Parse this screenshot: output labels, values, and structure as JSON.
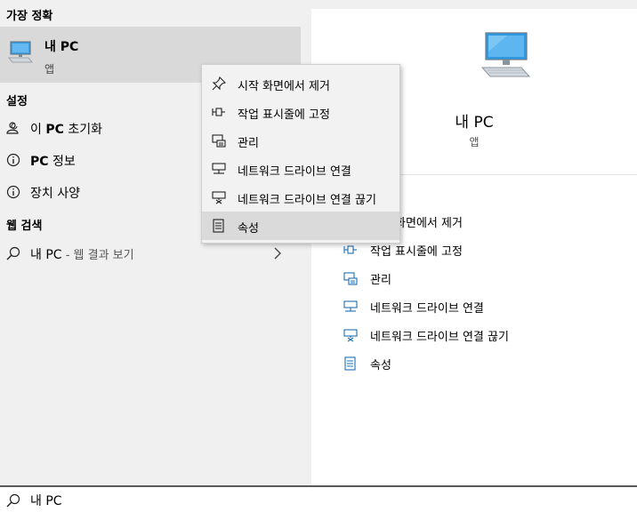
{
  "left": {
    "best_match_header": "가장 정확",
    "best_match": {
      "title": "내 PC",
      "subtitle": "앱"
    },
    "settings_header": "설정",
    "settings": [
      {
        "prefix": "이 ",
        "bold": "PC",
        "suffix": " 초기화",
        "icon": "reset-user-icon"
      },
      {
        "prefix": "",
        "bold": "PC",
        "suffix": " 정보",
        "icon": "info-icon"
      },
      {
        "prefix": "",
        "bold": "",
        "suffix": "장치 사양",
        "icon": "info-icon"
      }
    ],
    "web_header": "웹 검색",
    "web_result": {
      "text": "내 PC",
      "suffix": " - 웹 결과 보기"
    }
  },
  "preview": {
    "title": "내 PC",
    "subtitle": "앱",
    "actions": [
      {
        "label": "시작 화면에서 제거",
        "icon": "unpin-icon"
      },
      {
        "label": "작업 표시줄에 고정",
        "icon": "pin-icon"
      },
      {
        "label": "관리",
        "icon": "manage-icon"
      },
      {
        "label": "네트워크 드라이브 연결",
        "icon": "map-network-drive-icon"
      },
      {
        "label": "네트워크 드라이브 연결 끊기",
        "icon": "disconnect-network-drive-icon"
      },
      {
        "label": "속성",
        "icon": "properties-icon"
      }
    ]
  },
  "context_menu": {
    "items": [
      {
        "label": "시작 화면에서 제거",
        "icon": "unpin-icon"
      },
      {
        "label": "작업 표시줄에 고정",
        "icon": "pin-icon"
      },
      {
        "label": "관리",
        "icon": "manage-icon"
      },
      {
        "label": "네트워크 드라이브 연결",
        "icon": "map-network-drive-icon"
      },
      {
        "label": "네트워크 드라이브 연결 끊기",
        "icon": "disconnect-network-drive-icon"
      },
      {
        "label": "속성",
        "icon": "properties-icon",
        "highlighted": true
      }
    ]
  },
  "search": {
    "query": "내 PC",
    "icon": "search-icon"
  },
  "colors": {
    "accent": "#1f6fb2",
    "highlight": "#d9d9d9",
    "panel": "#f0f0f0",
    "card": "#ffffff"
  }
}
